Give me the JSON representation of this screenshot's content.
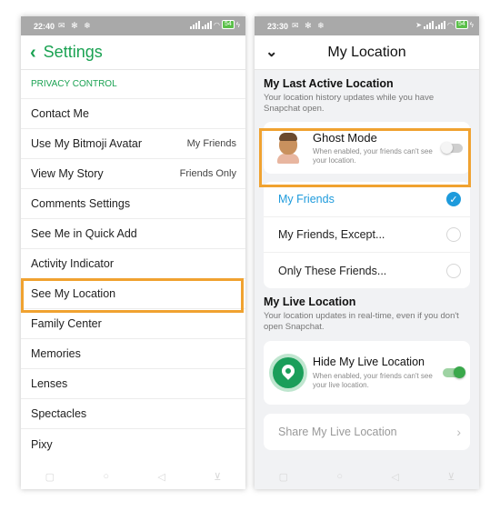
{
  "left": {
    "status": {
      "time": "22:40",
      "icons": "✉ ✻ ❄",
      "battery": "54"
    },
    "title": "Settings",
    "section": "PRIVACY CONTROL",
    "rows": [
      {
        "label": "Contact Me",
        "value": ""
      },
      {
        "label": "Use My Bitmoji Avatar",
        "value": "My Friends"
      },
      {
        "label": "View My Story",
        "value": "Friends Only"
      },
      {
        "label": "Comments Settings",
        "value": ""
      },
      {
        "label": "See Me in Quick Add",
        "value": ""
      },
      {
        "label": "Activity Indicator",
        "value": ""
      },
      {
        "label": "See My Location",
        "value": ""
      },
      {
        "label": "Family Center",
        "value": ""
      },
      {
        "label": "Memories",
        "value": ""
      },
      {
        "label": "Lenses",
        "value": ""
      },
      {
        "label": "Spectacles",
        "value": ""
      },
      {
        "label": "Pixy",
        "value": ""
      }
    ]
  },
  "right": {
    "status": {
      "time": "23:30",
      "icons": "✉ ✻ ❄",
      "battery": "54"
    },
    "title": "My Location",
    "last_active": {
      "title": "My Last Active Location",
      "desc": "Your location history updates while you have Snapchat open."
    },
    "ghost": {
      "title": "Ghost Mode",
      "desc": "When enabled, your friends can't see your location.",
      "enabled": false
    },
    "options": [
      {
        "label": "My Friends",
        "selected": true
      },
      {
        "label": "My Friends, Except...",
        "selected": false
      },
      {
        "label": "Only These Friends...",
        "selected": false
      }
    ],
    "live": {
      "title": "My Live Location",
      "desc": "Your location updates in real-time, even if you don't open Snapchat.",
      "hide_title": "Hide My Live Location",
      "hide_desc": "When enabled, your friends can't see your live location.",
      "enabled": true
    },
    "share_label": "Share My Live Location"
  },
  "colors": {
    "accent_green": "#1aa252",
    "highlight_orange": "#f0a230",
    "snap_blue": "#1e9bdc"
  }
}
